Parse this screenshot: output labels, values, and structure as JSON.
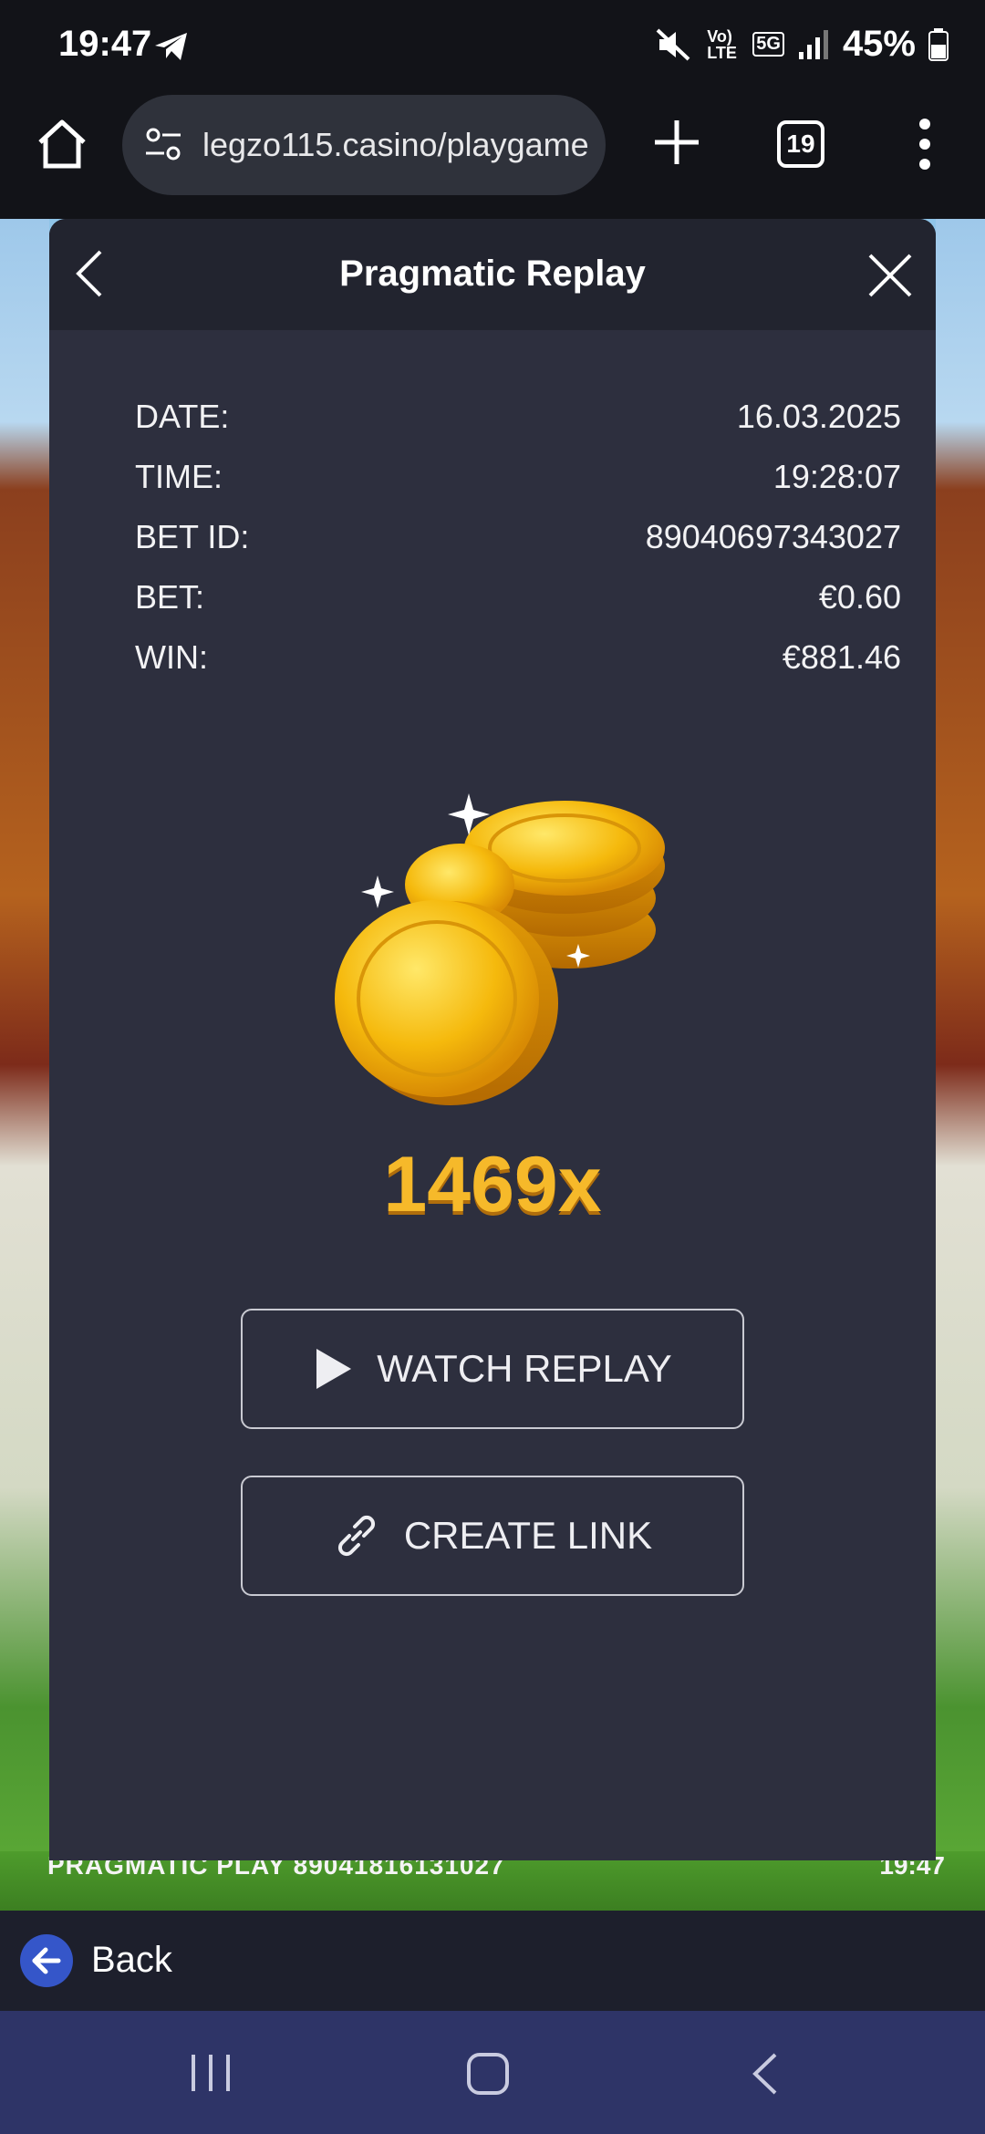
{
  "status_bar": {
    "time": "19:47",
    "network": "Vo) LTE",
    "net_badge": "5G",
    "battery": "45%"
  },
  "browser": {
    "url": "legzo115.casino/playgame",
    "tab_count": "19"
  },
  "game": {
    "footer_left": "PRAGMATIC PLAY  89041816131027",
    "footer_right": "19:47"
  },
  "modal": {
    "title": "Pragmatic Replay",
    "rows": [
      {
        "label": "DATE:",
        "value": "16.03.2025"
      },
      {
        "label": "TIME:",
        "value": "19:28:07"
      },
      {
        "label": "BET ID:",
        "value": "89040697343027"
      },
      {
        "label": "BET:",
        "value": "€0.60"
      },
      {
        "label": "WIN:",
        "value": "€881.46"
      }
    ],
    "multiplier": "1469x",
    "watch_replay_label": "WATCH REPLAY",
    "create_link_label": "CREATE LINK"
  },
  "back_bar": {
    "label": "Back"
  },
  "colors": {
    "modal_bg": "#2d2f3e",
    "modal_header_bg": "#22242f",
    "multiplier": "#f6b92a",
    "back_circle": "#3556c9",
    "nav_bar": "#2e3467"
  },
  "icons": [
    "telegram-icon",
    "mute-icon",
    "signal-icon",
    "battery-icon",
    "home-icon",
    "tune-icon",
    "plus-icon",
    "tabs-icon",
    "more-vert-icon",
    "chevron-left-icon",
    "close-icon",
    "coins-icon",
    "play-icon",
    "link-icon",
    "arrow-left-icon",
    "recent-apps-icon",
    "home-circle-icon",
    "nav-back-icon"
  ]
}
